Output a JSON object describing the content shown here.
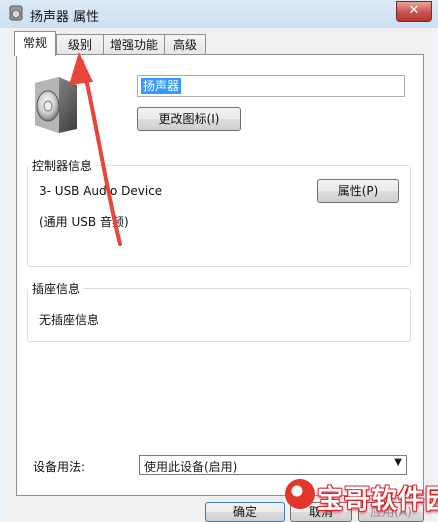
{
  "window": {
    "title": "扬声器 属性",
    "close_glyph": "✕"
  },
  "tabs": [
    {
      "label": "常规",
      "active": true
    },
    {
      "label": "级别",
      "active": false
    },
    {
      "label": "增强功能",
      "active": false
    },
    {
      "label": "高级",
      "active": false
    }
  ],
  "general": {
    "device_name_value": "扬声器",
    "change_icon_button": "更改图标(I)",
    "controller_group": {
      "label": "控制器信息",
      "device": "3- USB Audio Device",
      "subtitle": "(通用 USB 音频)",
      "properties_button": "属性(P)"
    },
    "jack_group": {
      "label": "插座信息",
      "info": "无插座信息"
    },
    "usage": {
      "label": "设备用法:",
      "selected": "使用此设备(启用)"
    }
  },
  "footer": {
    "ok": "确定",
    "cancel": "取消",
    "apply": "应用(A)"
  },
  "watermark": {
    "text": "宝哥软件园"
  },
  "colors": {
    "selection": "#3399ff",
    "arrow": "#e8463a",
    "watermark": "#d7262b"
  },
  "icons": {
    "title": "speaker-icon",
    "device": "speaker-icon",
    "close": "close-icon"
  }
}
